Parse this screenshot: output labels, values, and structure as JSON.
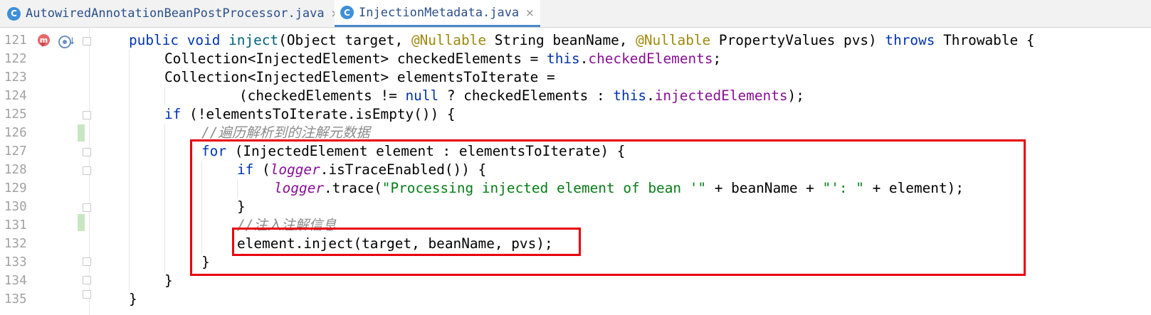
{
  "tabs": [
    {
      "icon": "C",
      "label": "AutowiredAnnotationBeanPostProcessor.java",
      "close": "×",
      "active": false
    },
    {
      "icon": "C",
      "label": "InjectionMetadata.java",
      "close": "×",
      "active": true
    }
  ],
  "gutter": {
    "line_numbers": [
      "121",
      "122",
      "123",
      "124",
      "125",
      "126",
      "127",
      "128",
      "129",
      "130",
      "131",
      "132",
      "133",
      "134",
      "135"
    ],
    "method_icon": "m"
  },
  "code": {
    "l121": {
      "t1": "public void ",
      "t2": "inject",
      "t3": "(Object target, ",
      "t4": "@Nullable",
      "t5": " String beanName, ",
      "t6": "@Nullable",
      "t7": " PropertyValues pvs) ",
      "t8": "throws",
      "t9": " Throwable {"
    },
    "l122": {
      "t1": "Collection<InjectedElement> checkedElements = ",
      "t2": "this",
      "t3": ".",
      "t4": "checkedElements",
      "t5": ";"
    },
    "l123": {
      "t1": "Collection<InjectedElement> elementsToIterate ="
    },
    "l124": {
      "t1": "(checkedElements != ",
      "t2": "null",
      "t3": " ? checkedElements : ",
      "t4": "this",
      "t5": ".",
      "t6": "injectedElements",
      "t7": ");"
    },
    "l125": {
      "t1": "if",
      "t2": " (!elementsToIterate.isEmpty()) {"
    },
    "l126": {
      "t1": "//遍历解析到的注解元数据"
    },
    "l127": {
      "t1": "for",
      "t2": " (InjectedElement element : elementsToIterate) {"
    },
    "l128": {
      "t1": "if",
      "t2": " (",
      "t3": "logger",
      "t4": ".isTraceEnabled()) {"
    },
    "l129": {
      "t1": "logger",
      "t2": ".trace(",
      "t3": "\"Processing injected element of bean '\"",
      "t4": " + beanName + ",
      "t5": "\"': \"",
      "t6": " + element);"
    },
    "l130": {
      "t1": "}"
    },
    "l131": {
      "t1": "//注入注解信息"
    },
    "l132": {
      "t1": "element.inject(target, beanName, pvs);"
    },
    "l133": {
      "t1": "}"
    },
    "l134": {
      "t1": "}"
    },
    "l135": {
      "t1": "}"
    }
  },
  "colors": {
    "keyword": "#0033b3",
    "annotation": "#9e880d",
    "field": "#871094",
    "string": "#067d17",
    "comment": "#8c8c8c",
    "highlight": "#e8000b"
  }
}
